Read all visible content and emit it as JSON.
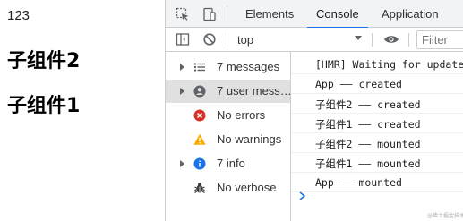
{
  "page": {
    "counter": "123",
    "heading_a": "子组件2",
    "heading_b": "子组件1"
  },
  "devtools": {
    "tabs": [
      {
        "label": "Elements"
      },
      {
        "label": "Console",
        "active": true
      },
      {
        "label": "Application"
      }
    ],
    "toolbar": {
      "context": "top",
      "filter_placeholder": "Filter"
    },
    "sidebar": {
      "items": [
        {
          "label": "7 messages",
          "icon": "list-icon",
          "expandable": true
        },
        {
          "label": "7 user mess…",
          "icon": "user-icon",
          "expandable": true,
          "selected": true
        },
        {
          "label": "No errors",
          "icon": "error-icon",
          "expandable": false
        },
        {
          "label": "No warnings",
          "icon": "warning-icon",
          "expandable": false
        },
        {
          "label": "7 info",
          "icon": "info-icon",
          "expandable": true
        },
        {
          "label": "No verbose",
          "icon": "bug-icon",
          "expandable": false
        }
      ]
    },
    "console": {
      "messages": [
        "[HMR] Waiting for update",
        "App —— created",
        "子组件2 —— created",
        "子组件1 —— created",
        "子组件2 —— mounted",
        "子组件1 —— mounted",
        "App —— mounted"
      ]
    }
  },
  "colors": {
    "accent": "#1a73e8",
    "error": "#d93025",
    "warning": "#f9ab00",
    "info": "#1a73e8",
    "selected_bg": "#e0e0e0"
  },
  "watermark": "@稀土掘金技术社区"
}
